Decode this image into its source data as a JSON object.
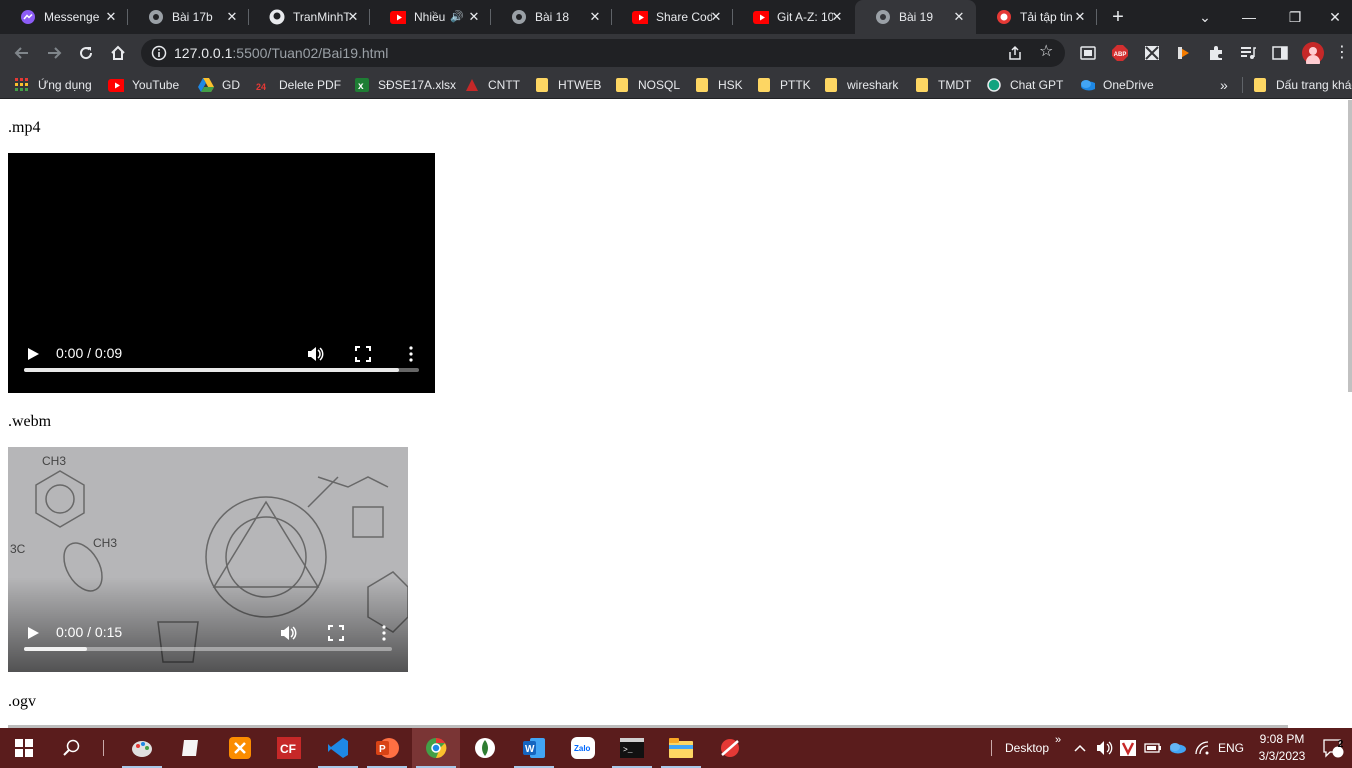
{
  "tabs": [
    {
      "title": "Messenger",
      "icon": "messenger-icon"
    },
    {
      "title": "Bài 17b",
      "icon": "globe-icon"
    },
    {
      "title": "TranMinhT",
      "icon": "github-icon"
    },
    {
      "title": "Nhiều",
      "icon": "youtube-icon"
    },
    {
      "title": "Bài 18",
      "icon": "globe-icon"
    },
    {
      "title": "Share Code",
      "icon": "youtube-icon"
    },
    {
      "title": "Git A-Z: 10",
      "icon": "youtube-icon"
    },
    {
      "title": "Bài 19",
      "icon": "globe-icon",
      "active": true
    },
    {
      "title": "Tải tập tin",
      "icon": "download-site-icon"
    }
  ],
  "address": {
    "host": "127.0.0.1",
    "path": ":5500/Tuan02/Bai19.html"
  },
  "bookmarks": [
    {
      "label": "Ứng dụng",
      "icon": "apps-grid-icon"
    },
    {
      "label": "YouTube",
      "icon": "youtube-icon"
    },
    {
      "label": "GD",
      "icon": "google-drive-icon"
    },
    {
      "label": "Delete PDF",
      "icon": "pdf-icon"
    },
    {
      "label": "SĐSE17A.xlsx",
      "icon": "excel-icon"
    },
    {
      "label": "CNTT",
      "icon": "site-icon"
    },
    {
      "label": "HTWEB",
      "icon": "folder-icon"
    },
    {
      "label": "NOSQL",
      "icon": "folder-icon"
    },
    {
      "label": "HSK",
      "icon": "folder-icon"
    },
    {
      "label": "PTTK",
      "icon": "folder-icon"
    },
    {
      "label": "wireshark",
      "icon": "folder-icon"
    },
    {
      "label": "TMDT",
      "icon": "folder-icon"
    },
    {
      "label": "Chat  GPT",
      "icon": "chatgpt-icon"
    },
    {
      "label": "OneDrive",
      "icon": "onedrive-icon"
    }
  ],
  "bookmarks_overflow": "»",
  "other_bookmarks": "Dấu trang khác",
  "page": {
    "sections": [
      {
        "label": ".mp4",
        "time": "0:00 / 0:09",
        "progress": 0.0,
        "buffered": 0.95
      },
      {
        "label": ".webm",
        "time": "0:00 / 0:15",
        "progress": 0.0,
        "buffered": 0.17
      },
      {
        "label": ".ogv"
      }
    ]
  },
  "taskbar": {
    "apps": [
      "paint-icon",
      "notes-icon",
      "xampp-icon",
      "cf-icon",
      "vscode-icon",
      "powerpoint-icon",
      "chrome-icon",
      "mongodb-icon",
      "word-icon",
      "zalo-icon",
      "terminal-icon",
      "file-explorer-icon",
      "snipping-icon"
    ],
    "desktop_label": "Desktop",
    "language": "ENG",
    "time": "9:08 PM",
    "date": "3/3/2023",
    "notifications": "2"
  },
  "colors": {
    "tab_bar": "#202124",
    "toolbar": "#35363a",
    "taskbar": "#5a1c1c",
    "video_black": "#000000"
  }
}
